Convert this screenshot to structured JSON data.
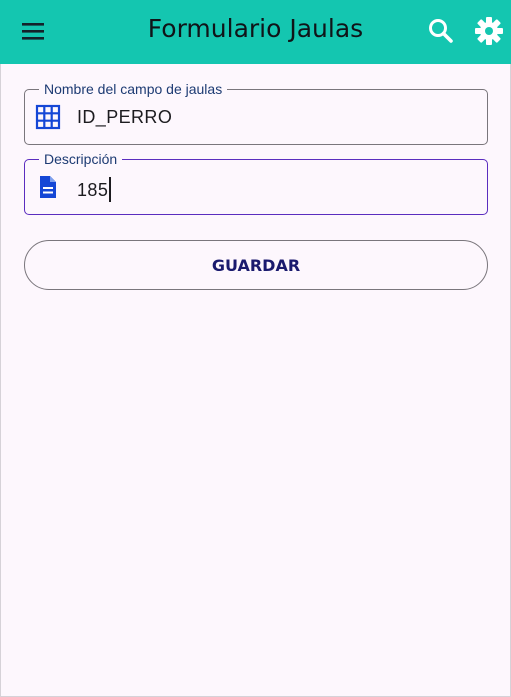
{
  "app_bar": {
    "title": "Formulario Jaulas",
    "icons": [
      "menu-icon",
      "search-icon",
      "gear-icon"
    ],
    "background": "#14c6b0"
  },
  "form": {
    "field_name": {
      "label": "Nombre del campo de jaulas",
      "value": "ID_PERRO",
      "icon": "grid-icon"
    },
    "field_description": {
      "label": "Descripción",
      "value": "185",
      "icon": "document-icon",
      "focused": true
    },
    "save_label": "GUARDAR"
  },
  "colors": {
    "accent": "#5b2dbf",
    "icon_blue": "#1547d6",
    "label": "#1d3b73"
  }
}
